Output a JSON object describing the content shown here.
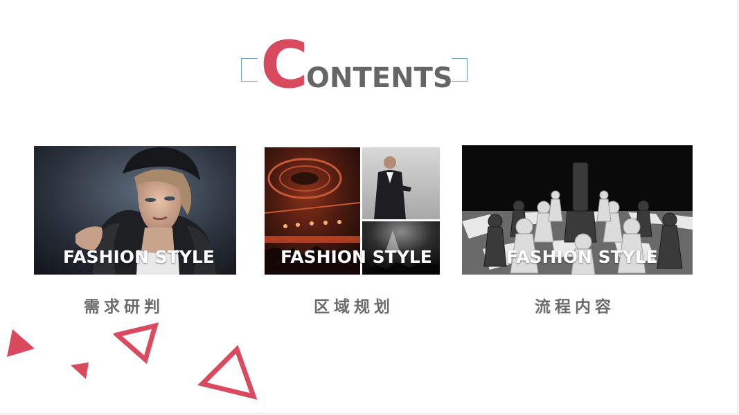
{
  "title": {
    "initial": "C",
    "rest": "ONTENTS"
  },
  "cards": [
    {
      "caption": "FASHION STYLE",
      "label": "需求研判"
    },
    {
      "caption": "FASHION STYLE",
      "label": "区域规划"
    },
    {
      "caption": "FASHION STYLE",
      "label": "流程内容"
    }
  ],
  "colors": {
    "accent": "#d94a5f",
    "title_gray": "#666666",
    "frame_blue": "#6f9fd0",
    "label_gray": "#6b6b6b"
  }
}
